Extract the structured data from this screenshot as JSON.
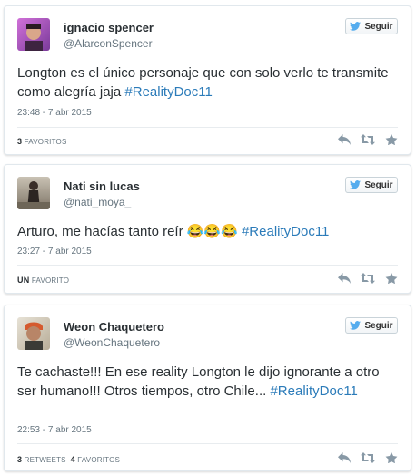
{
  "follow_label": "Seguir",
  "colors": {
    "link": "#2b7bb9",
    "icon": "#8899a6",
    "twitter_bird": "#55acee"
  },
  "icons": {
    "follow": "twitter-bird-icon",
    "reply": "reply-icon",
    "retweet": "retweet-icon",
    "favorite": "star-icon"
  },
  "tweets": [
    {
      "name": "ignacio spencer",
      "handle": "@AlarconSpencer",
      "text_before": "Longton es el único personaje que con solo verlo te transmite como alegría jaja ",
      "hashtag": "#RealityDoc11",
      "time": "23:48 - 7 abr 2015",
      "favorites_count": "3",
      "favorites_label": "FAVORITOS"
    },
    {
      "name": "Nati sin lucas",
      "handle": "@nati_moya_",
      "text_before": "Arturo, me hacías tanto reír ",
      "emoji": "😂😂😂",
      "hashtag": "#RealityDoc11",
      "time": "23:27 - 7 abr 2015",
      "favorites_count": "UN",
      "favorites_label": "FAVORITO"
    },
    {
      "name": "Weon Chaquetero",
      "handle": "@WeonChaquetero",
      "text_before": "Te cachaste!!! En ese reality Longton le dijo ignorante a otro ser humano!!! Otros tiempos, otro Chile... ",
      "hashtag": "#RealityDoc11",
      "time": "22:53 - 7 abr 2015",
      "retweets_count": "3",
      "retweets_label": "RETWEETS",
      "favorites_count": "4",
      "favorites_label": "FAVORITOS"
    }
  ]
}
